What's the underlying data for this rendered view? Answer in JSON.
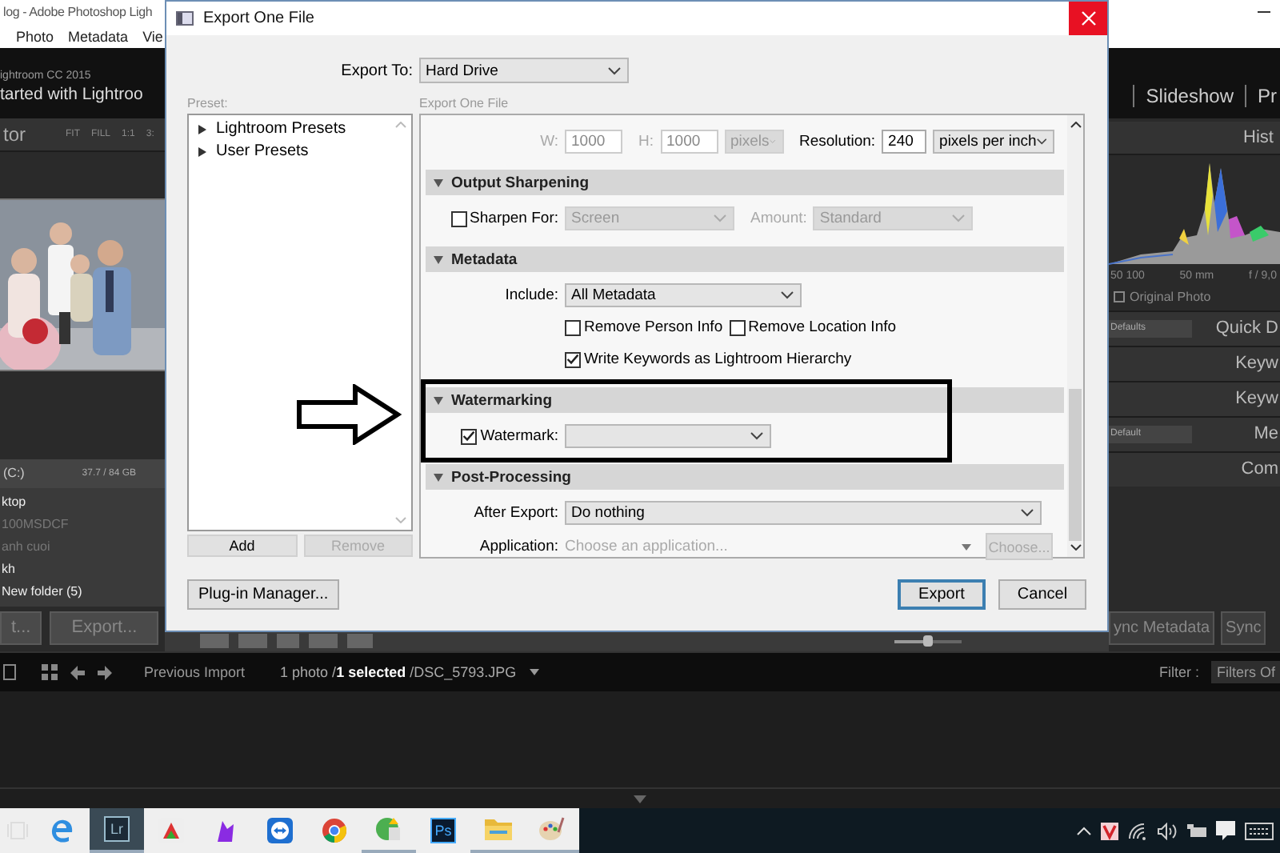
{
  "lightroom": {
    "title": "log - Adobe Photoshop Ligh",
    "menu": [
      "Photo",
      "Metadata",
      "Vie"
    ],
    "identity": {
      "subtitle": "ightroom CC 2015",
      "title": "tarted with Lightroo"
    },
    "modules": [
      "Slideshow",
      "Pr"
    ],
    "navigator": {
      "title": "tor",
      "zoom": [
        "FIT",
        "FILL",
        "1:1",
        "3:"
      ]
    },
    "photo": {
      "kind": "picture"
    },
    "volume": {
      "name": "(C:)",
      "usage": "37.7 / 84 GB"
    },
    "folders": [
      {
        "name": "ktop",
        "dimmed": false
      },
      {
        "name": "100MSDCF",
        "dimmed": true
      },
      {
        "name": "anh cuoi",
        "dimmed": true
      },
      {
        "name": "kh",
        "dimmed": false
      },
      {
        "name": "New folder (5)",
        "dimmed": false
      }
    ],
    "left_buttons": [
      "t...",
      "Export..."
    ],
    "toolbar_slider": {
      "level": 0.5
    },
    "histogram": {
      "title": "Hist",
      "info": [
        "50 100",
        "50 mm",
        "f / 9,0"
      ],
      "original_photo": {
        "label": "Original Photo",
        "checked": false
      }
    },
    "panels": [
      {
        "kind": "preset",
        "preset": "Defaults",
        "title": "Quick D"
      },
      {
        "kind": "plain",
        "title": "Keyw"
      },
      {
        "kind": "plain",
        "title": "Keyw"
      },
      {
        "kind": "preset",
        "preset": "Default",
        "title": "Me"
      },
      {
        "kind": "plain",
        "title": "Com"
      }
    ],
    "sync_buttons": [
      "ync Metadata",
      "Sync"
    ],
    "filmstrip": {
      "source": "Previous Import",
      "selection": "1 photo /**1 selected** /DSC_5793.JPG",
      "filter_label": "Filter :",
      "filter_value": "Filters Of"
    }
  },
  "dialog": {
    "title": "Export One File",
    "export_to": {
      "label": "Export To:",
      "value": "Hard Drive"
    },
    "preset_label": "Preset:",
    "presets": [
      {
        "name": "Lightroom Presets",
        "expanded": false
      },
      {
        "name": "User Presets",
        "expanded": false
      }
    ],
    "preset_buttons": [
      {
        "label": "Add",
        "disabled": false
      },
      {
        "label": "Remove",
        "disabled": true
      }
    ],
    "panel_title": "Export One File",
    "sections": [
      {
        "rows": [
          [
            {
              "kind": "label",
              "text": "W:",
              "disabled": true
            },
            {
              "kind": "field",
              "value": "1000",
              "disabled": true
            },
            {
              "kind": "label",
              "text": "H:",
              "disabled": true
            },
            {
              "kind": "field",
              "value": "1000",
              "disabled": true
            },
            {
              "kind": "select",
              "value": "pixels",
              "disabled": true
            },
            {
              "kind": "label",
              "text": "Resolution:",
              "disabled": false
            },
            {
              "kind": "field",
              "value": "240",
              "disabled": false
            },
            {
              "kind": "select",
              "value": "pixels per inch",
              "disabled": false
            }
          ]
        ]
      },
      {
        "title": "Output Sharpening",
        "expanded": true,
        "rows": [
          [
            {
              "kind": "checkbox",
              "text": "Sharpen For:",
              "checked": false
            },
            {
              "kind": "select",
              "value": "Screen",
              "disabled": true
            },
            {
              "kind": "label",
              "text": "Amount:",
              "disabled": true
            },
            {
              "kind": "select",
              "value": "Standard",
              "disabled": true
            }
          ]
        ]
      },
      {
        "title": "Metadata",
        "expanded": true,
        "rows": [
          [
            {
              "kind": "label",
              "text": "Include:",
              "disabled": false
            },
            {
              "kind": "select",
              "value": "All Metadata",
              "disabled": false
            }
          ],
          [
            "",
            {
              "kind": "checkbox",
              "text": "Remove Person Info",
              "checked": false
            },
            {
              "kind": "checkbox",
              "text": "Remove Location Info",
              "checked": false
            }
          ],
          [
            "",
            {
              "kind": "checkbox",
              "text": "Write Keywords as Lightroom Hierarchy",
              "checked": true
            }
          ]
        ]
      },
      {
        "title": "Watermarking",
        "expanded": true,
        "highlighted": true,
        "rows": [
          [
            {
              "kind": "checkbox",
              "text": "Watermark:",
              "checked": true
            },
            {
              "kind": "select",
              "disabled": false
            }
          ]
        ]
      },
      {
        "title": "Post-Processing",
        "expanded": true,
        "rows": [
          [
            {
              "kind": "label",
              "text": "After Export:",
              "disabled": false
            },
            {
              "kind": "select",
              "value": "Do nothing",
              "disabled": false
            }
          ],
          [
            {
              "kind": "label",
              "text": "Application:",
              "disabled": false
            },
            {
              "kind": "combo",
              "placeholder": "Choose an application...",
              "disabled": true
            },
            {
              "kind": "button",
              "text": "Choose...",
              "disabled": true
            }
          ]
        ]
      }
    ],
    "buttons": [
      {
        "label": "Plug-in Manager...",
        "kind": "normal"
      },
      {
        "label": "Export",
        "kind": "default"
      },
      {
        "label": "Cancel",
        "kind": "normal"
      }
    ]
  },
  "taskbar": {
    "apps": [
      {
        "kind": "task-view",
        "selected": false,
        "running": false
      },
      {
        "kind": "edge",
        "selected": false,
        "running": false
      },
      {
        "kind": "lightroom",
        "label": "Lr",
        "selected": true,
        "running": true
      },
      {
        "kind": "photo-app",
        "selected": false,
        "running": false
      },
      {
        "kind": "purple-app",
        "selected": false,
        "running": false
      },
      {
        "kind": "remote",
        "selected": false,
        "running": false
      },
      {
        "kind": "chrome",
        "selected": false,
        "running": false
      },
      {
        "kind": "green-app",
        "selected": false,
        "running": true
      },
      {
        "kind": "photoshop",
        "label": "Ps",
        "selected": false,
        "running": false
      },
      {
        "kind": "folder",
        "selected": false,
        "running": true
      },
      {
        "kind": "paint",
        "selected": false,
        "running": true
      }
    ],
    "tray": [
      {
        "kind": "chevron"
      },
      {
        "kind": "shield"
      },
      {
        "kind": "wifi"
      },
      {
        "kind": "speaker"
      },
      {
        "kind": "battery"
      },
      {
        "kind": "notification"
      },
      {
        "kind": "keyboard"
      }
    ]
  }
}
